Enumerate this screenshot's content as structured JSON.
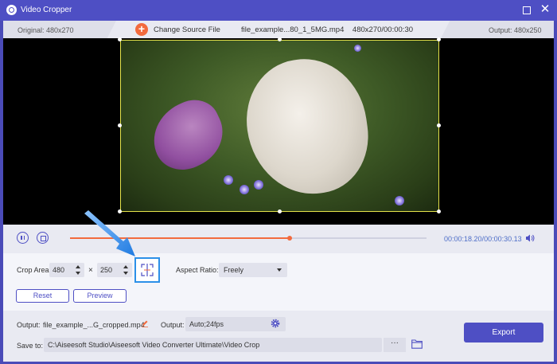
{
  "window": {
    "title": "Video Cropper"
  },
  "infobar": {
    "original_label": "Original: 480x270",
    "change_source_label": "Change Source File",
    "file_info": "file_example...80_1_5MG.mp4    480x270/00:00:30",
    "output_label": "Output: 480x250"
  },
  "playback": {
    "current_time": "00:00:18.20",
    "separator": "/",
    "total_time": "00:00:30.13",
    "progress_fraction": 0.617
  },
  "crop": {
    "area_label": "Crop Area:",
    "width": "480",
    "times": "×",
    "height": "250",
    "aspect_label": "Aspect Ratio:",
    "aspect_value": "Freely",
    "reset_label": "Reset",
    "preview_label": "Preview"
  },
  "footer": {
    "output_label": "Output:",
    "output_file": "file_example_...G_cropped.mp4",
    "output_format_label": "Output:",
    "output_format": "Auto;24fps",
    "save_label": "Save to:",
    "save_path": "C:\\Aiseesoft Studio\\Aiseesoft Video Converter Ultimate\\Video Crop",
    "browse_label": "···",
    "export_label": "Export"
  },
  "colors": {
    "accent": "#4e4fc4",
    "orange": "#f26a3d",
    "highlight": "#2c90e8",
    "crop_border": "#e5e34a"
  },
  "icons": [
    "app-icon",
    "maximize-icon",
    "close-icon",
    "add-icon",
    "pause-icon",
    "stop-icon",
    "volume-icon",
    "center-crop-icon",
    "chevron-down-icon",
    "pen-icon",
    "gear-icon",
    "folder-icon",
    "arrow-annotation"
  ]
}
